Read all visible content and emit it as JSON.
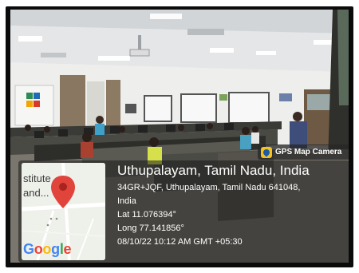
{
  "camera_tag": {
    "label": "GPS Map Camera",
    "icon": "map-pin-icon",
    "icon_color": "#f3c21c"
  },
  "map_thumbnail": {
    "text_line_1": "stitute",
    "text_line_2": "and...",
    "logo_text": "Google",
    "pin_color": "#e0443a"
  },
  "location": {
    "title": "Uthupalayam, Tamil Nadu, India",
    "address_line_1": "34GR+JQF, Uthupalayam, Tamil Nadu 641048,",
    "address_line_2": "India",
    "latitude": "Lat 11.076394°",
    "longitude": "Long 77.141856°",
    "timestamp": "08/10/22 10:12 AM GMT +05:30"
  }
}
